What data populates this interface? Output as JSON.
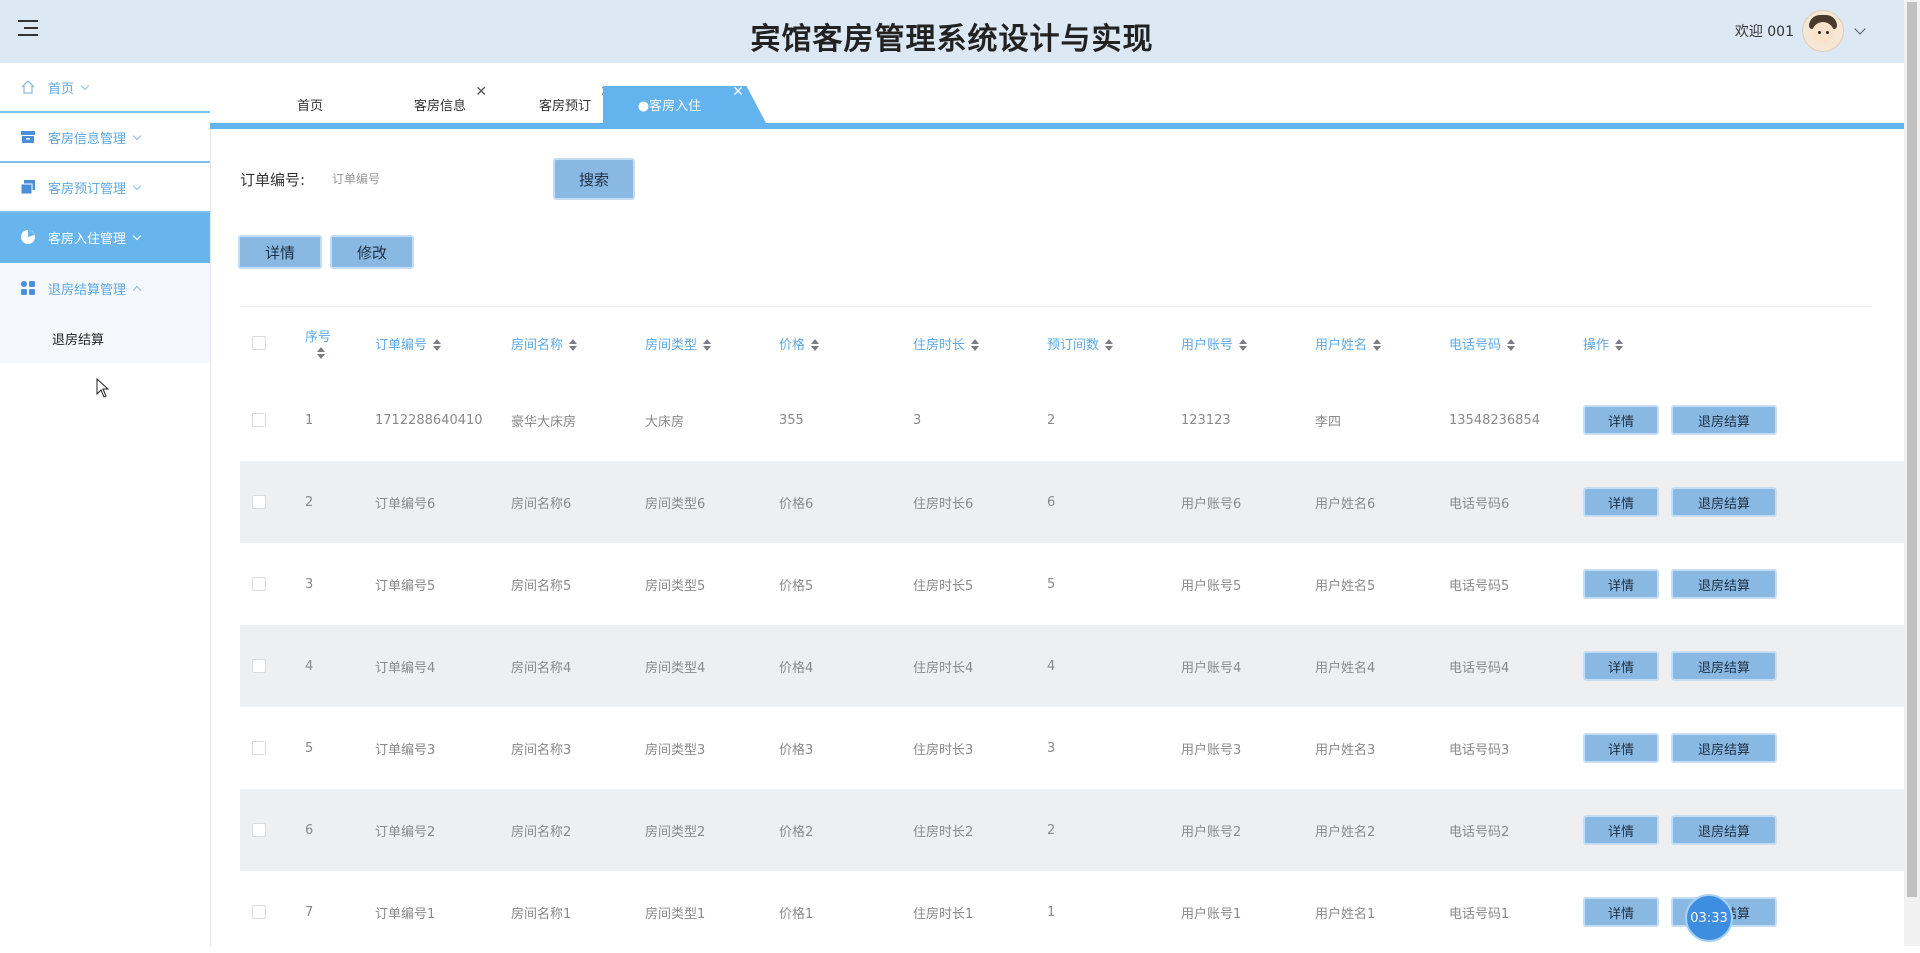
{
  "header": {
    "title": "宾馆客房管理系统设计与实现",
    "welcome": "欢迎 001"
  },
  "sidebar": {
    "items": [
      {
        "label": "首页",
        "icon": "home-icon"
      },
      {
        "label": "客房信息管理",
        "icon": "archive-icon"
      },
      {
        "label": "客房预订管理",
        "icon": "copy-icon"
      },
      {
        "label": "客房入住管理",
        "icon": "pie-chart-icon"
      },
      {
        "label": "退房结算管理",
        "icon": "grid-icon"
      }
    ],
    "sub_items": [
      {
        "label": "退房结算"
      }
    ]
  },
  "tabs": [
    {
      "label": "首页"
    },
    {
      "label": "客房信息",
      "close": "✕"
    },
    {
      "label": "客房预订",
      "close": "✕"
    },
    {
      "label": "●客房入住",
      "close": "✕"
    }
  ],
  "search": {
    "label": "订单编号:",
    "placeholder": "订单编号",
    "value": "",
    "button": "搜索"
  },
  "actions": {
    "detail": "详情",
    "edit": "修改"
  },
  "table": {
    "columns": [
      "序号",
      "订单编号",
      "房间名称",
      "房间类型",
      "价格",
      "住房时长",
      "预订间数",
      "用户账号",
      "用户姓名",
      "电话号码",
      "操作"
    ],
    "rows": [
      [
        "1",
        "1712288640410",
        "豪华大床房",
        "大床房",
        "355",
        "3",
        "2",
        "123123",
        "李四",
        "13548236854"
      ],
      [
        "2",
        "订单编号6",
        "房间名称6",
        "房间类型6",
        "价格6",
        "住房时长6",
        "6",
        "用户账号6",
        "用户姓名6",
        "电话号码6"
      ],
      [
        "3",
        "订单编号5",
        "房间名称5",
        "房间类型5",
        "价格5",
        "住房时长5",
        "5",
        "用户账号5",
        "用户姓名5",
        "电话号码5"
      ],
      [
        "4",
        "订单编号4",
        "房间名称4",
        "房间类型4",
        "价格4",
        "住房时长4",
        "4",
        "用户账号4",
        "用户姓名4",
        "电话号码4"
      ],
      [
        "5",
        "订单编号3",
        "房间名称3",
        "房间类型3",
        "价格3",
        "住房时长3",
        "3",
        "用户账号3",
        "用户姓名3",
        "电话号码3"
      ],
      [
        "6",
        "订单编号2",
        "房间名称2",
        "房间类型2",
        "价格2",
        "住房时长2",
        "2",
        "用户账号2",
        "用户姓名2",
        "电话号码2"
      ],
      [
        "7",
        "订单编号1",
        "房间名称1",
        "房间类型1",
        "价格1",
        "住房时长1",
        "1",
        "用户账号1",
        "用户姓名1",
        "电话号码1"
      ]
    ],
    "row_buttons": {
      "detail": "详情",
      "checkout": "退房结算"
    }
  },
  "timer": "03:33",
  "colors": {
    "accent": "#63b3ee",
    "header_bg": "#dce8f4",
    "button_bg": "#89b9e3"
  }
}
